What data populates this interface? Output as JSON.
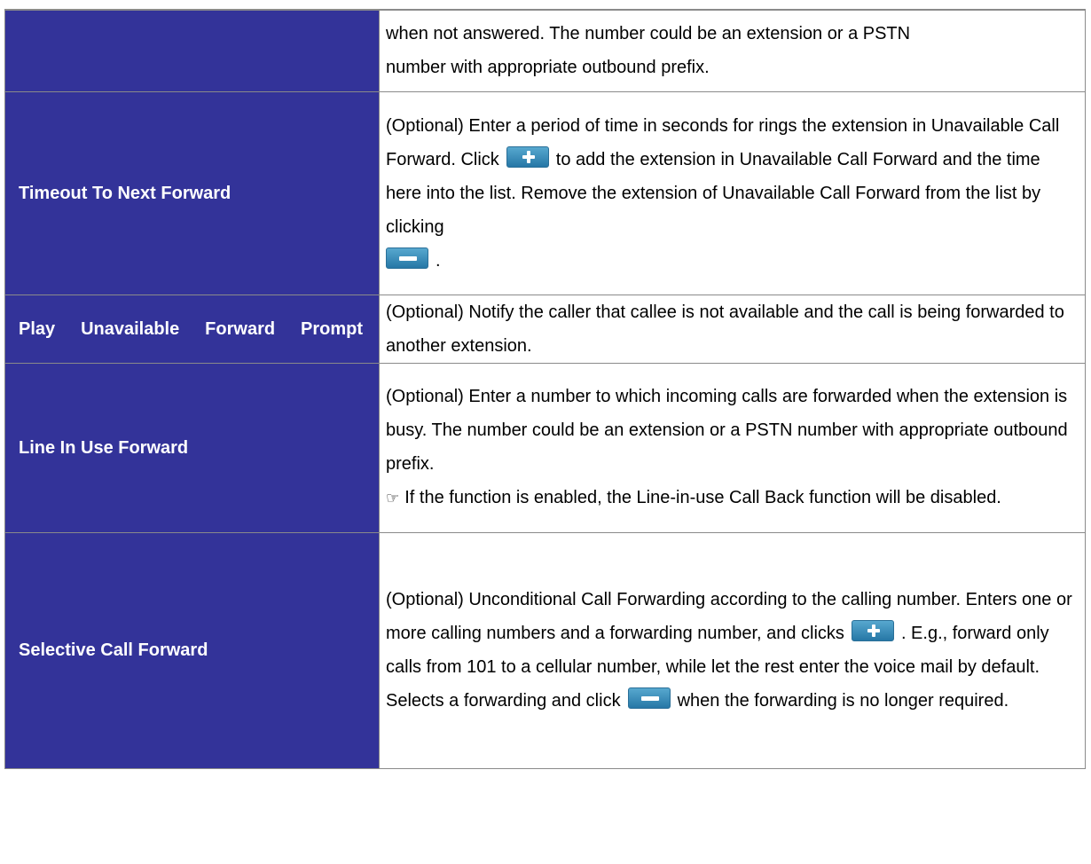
{
  "rows": [
    {
      "label": "",
      "desc": [
        "when not answered. The number could be an extension or a PSTN",
        "number with appropriate outbound prefix."
      ]
    },
    {
      "label": "Timeout To Next Forward",
      "desc_a": "(Optional) Enter a period of time in seconds for rings the extension in Unavailable Call Forward. Click",
      "desc_b": "to add the extension in Unavailable Call Forward and the time here into the list.   Remove the extension of Unavailable Call Forward from the list by clicking",
      "desc_c": "."
    },
    {
      "label": "Play Unavailable Forward Prompt",
      "desc": "(Optional) Notify the caller that callee is not available and the call is being forwarded to another extension."
    },
    {
      "label": "Line In Use Forward",
      "desc": "(Optional) Enter a number to which incoming calls are forwarded when the extension is busy. The number could be an extension or a PSTN number with appropriate outbound prefix.",
      "note": "If the function is enabled, the Line-in-use Call Back function will be disabled."
    },
    {
      "label": "Selective Call Forward",
      "desc_a": "(Optional) Unconditional Call Forwarding according to the calling number. Enters one or more calling numbers and a forwarding number, and clicks",
      "desc_b": ". E.g., forward only calls from 101 to a cellular number, while let the rest enter the voice mail by default. Selects a forwarding and click",
      "desc_c": "when the forwarding is no longer required."
    }
  ],
  "icons": {
    "note": "pointing-hand-icon",
    "add": "plus-button-icon",
    "remove": "minus-button-icon"
  },
  "colors": {
    "label_bg": "#333399",
    "button": "#3a8fbf"
  }
}
